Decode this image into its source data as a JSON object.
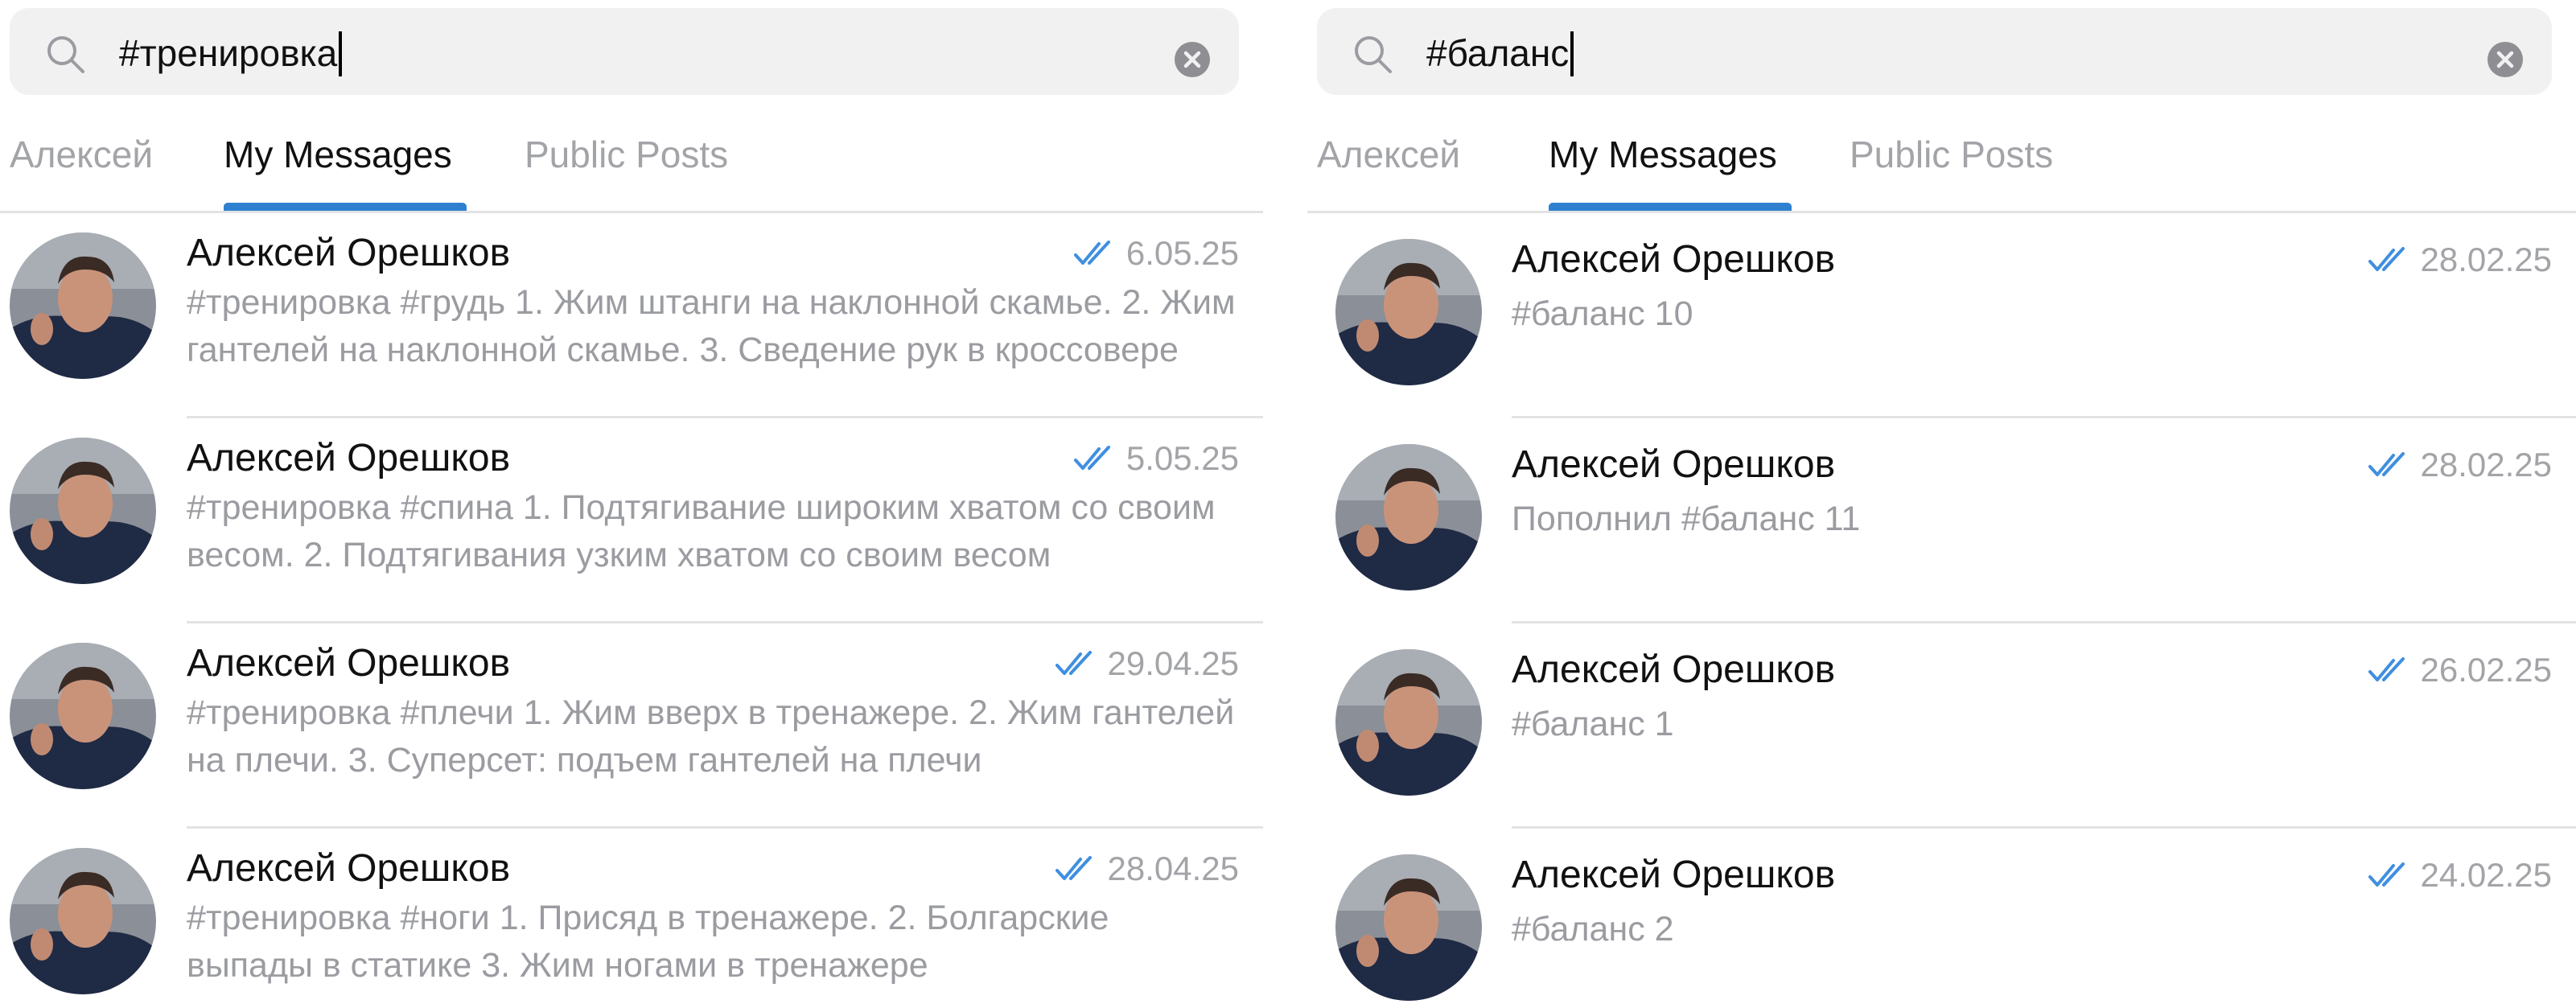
{
  "panels": [
    {
      "search": {
        "query": "#тренировка"
      },
      "tabs": [
        {
          "label": "Алексей",
          "active": false
        },
        {
          "label": "My Messages",
          "active": true
        },
        {
          "label": "Public Posts",
          "active": false
        }
      ],
      "results": [
        {
          "sender": "Алексей Орешков",
          "date": "6.05.25",
          "read": true,
          "preview": "#тренировка #грудь  1. Жим штанги на наклонной скамье. 2. Жим гантелей на наклонной скамье. 3. Сведение рук в кроссовере"
        },
        {
          "sender": "Алексей Орешков",
          "date": "5.05.25",
          "read": true,
          "preview": "#тренировка #спина   1. Подтягивание широким хватом со своим весом. 2. Подтягивания узким хватом со своим весом"
        },
        {
          "sender": "Алексей Орешков",
          "date": "29.04.25",
          "read": true,
          "preview": "#тренировка #плечи  1. Жим вверх в тренажере. 2. Жим гантелей на плечи. 3. Суперсет: подъем гантелей на плечи"
        },
        {
          "sender": "Алексей Орешков",
          "date": "28.04.25",
          "read": true,
          "preview": "#тренировка #ноги  1. Присяд в тренажере.  2. Болгарские выпады в статике 3. Жим ногами в тренажере"
        }
      ]
    },
    {
      "search": {
        "query": "#баланс"
      },
      "tabs": [
        {
          "label": "Алексей",
          "active": false
        },
        {
          "label": "My Messages",
          "active": true
        },
        {
          "label": "Public Posts",
          "active": false
        }
      ],
      "results": [
        {
          "sender": "Алексей Орешков",
          "date": "28.02.25",
          "read": true,
          "preview": "#баланс 10"
        },
        {
          "sender": "Алексей Орешков",
          "date": "28.02.25",
          "read": true,
          "preview": "Пополнил #баланс 11"
        },
        {
          "sender": "Алексей Орешков",
          "date": "26.02.25",
          "read": true,
          "preview": "#баланс 1"
        },
        {
          "sender": "Алексей Орешков",
          "date": "24.02.25",
          "read": true,
          "preview": "#баланс 2"
        }
      ]
    }
  ],
  "colors": {
    "accent": "#2f81d0",
    "read_check": "#3f8fe0",
    "secondary_text": "#9b9ca1",
    "search_bg": "#f1f1f2"
  },
  "icons": {
    "search": "search-icon",
    "clear": "clear-icon",
    "read_status": "double-check-icon",
    "avatar": "avatar"
  }
}
